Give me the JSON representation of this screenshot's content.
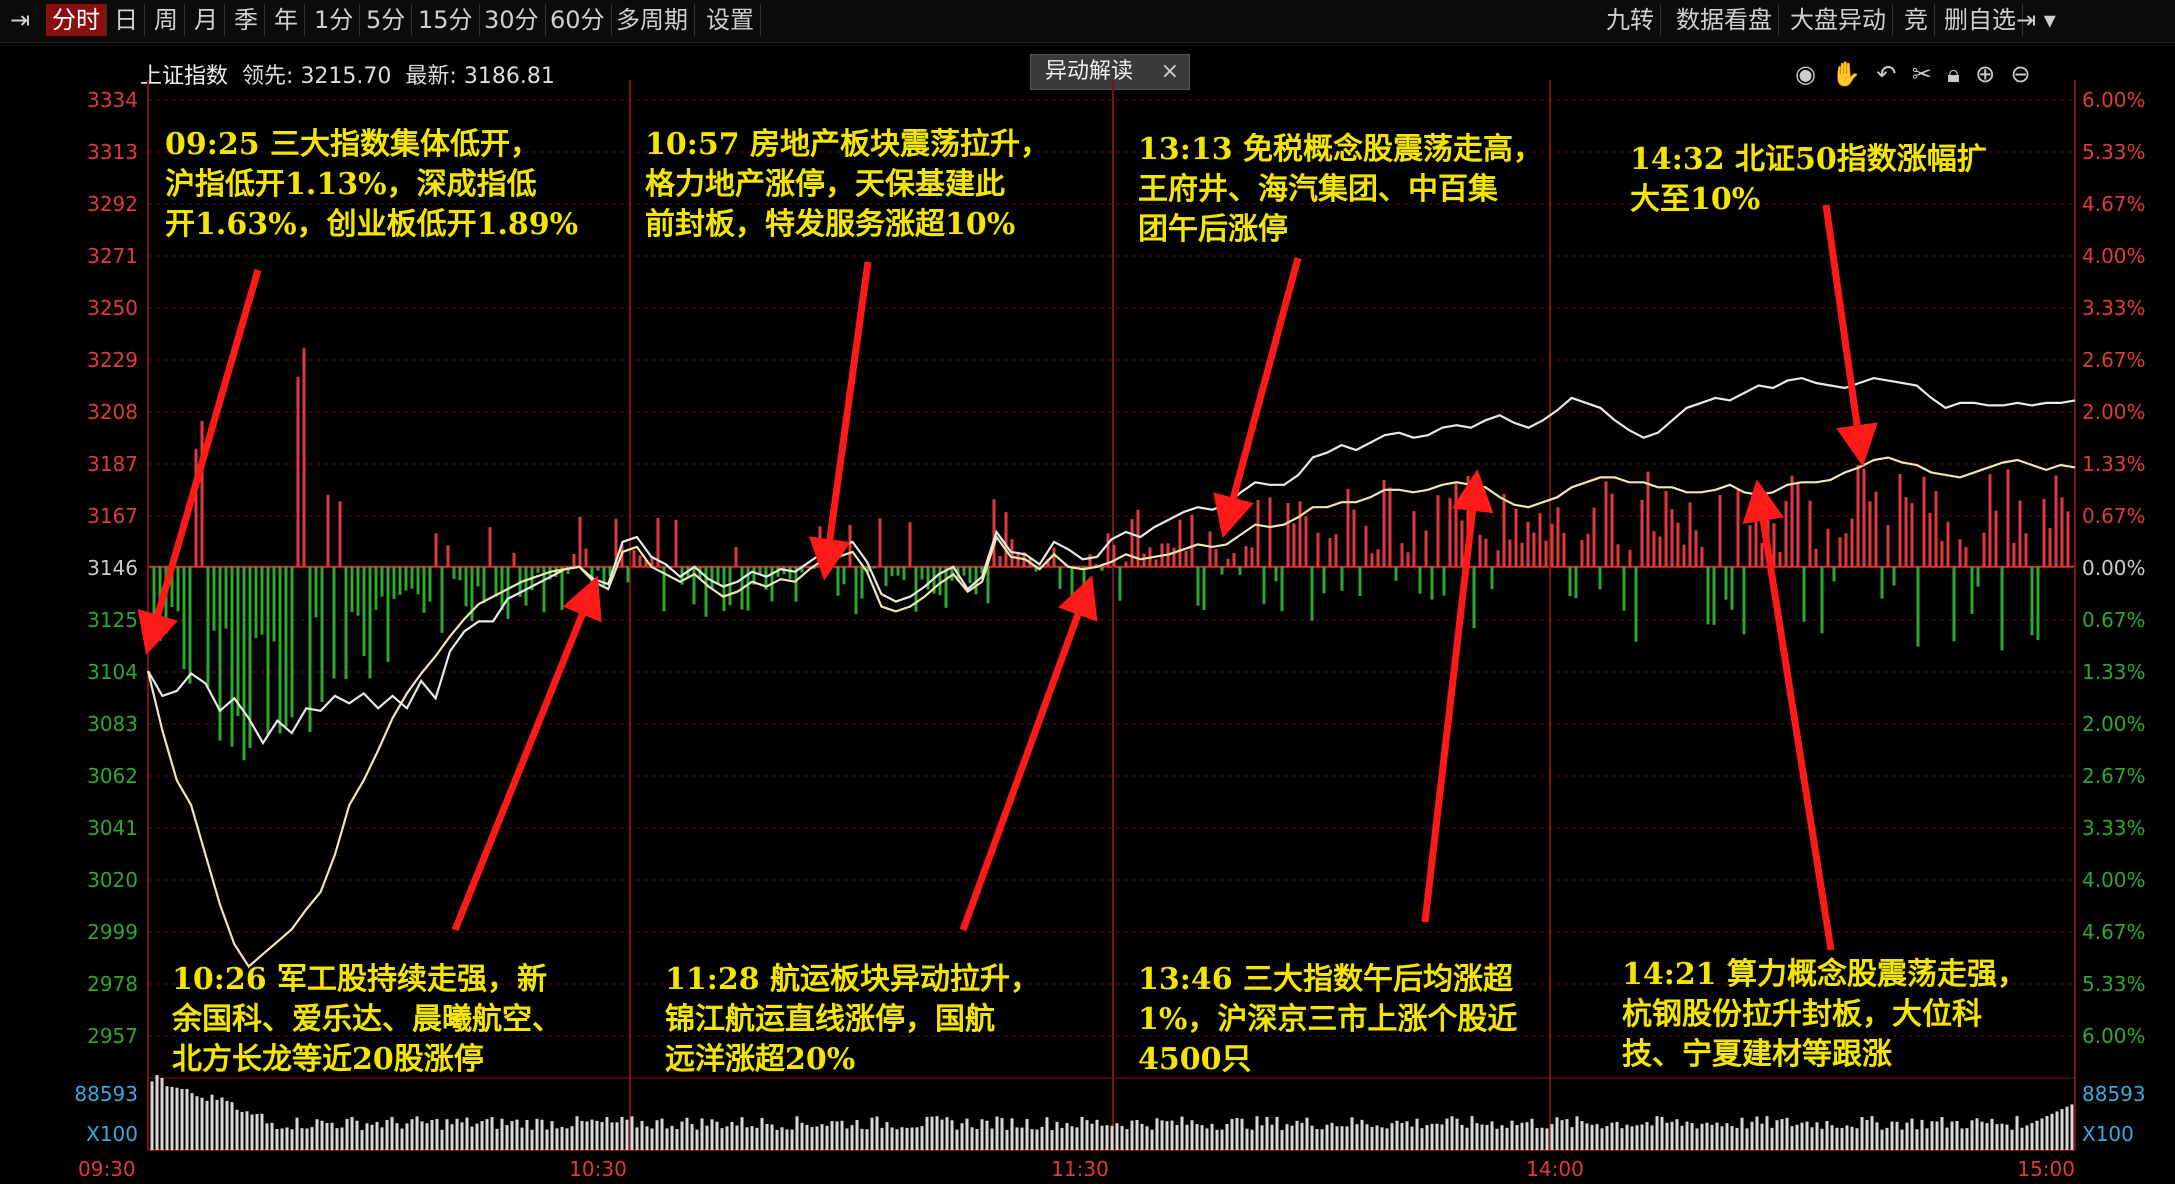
{
  "toolbar": {
    "pin_icon": "pin-icon",
    "tabs": [
      "分时",
      "日",
      "周",
      "月",
      "季",
      "年",
      "1分",
      "5分",
      "15分",
      "30分",
      "60分",
      "多周期",
      "设置"
    ],
    "active_tab": "分时",
    "right_items": [
      "九转",
      "数据看盘",
      "大盘异动",
      "竞",
      "删自选"
    ]
  },
  "info_bar": {
    "index_name": "上证指数",
    "leader_label": "领先:",
    "leader_value": "3215.70",
    "latest_label": "最新:",
    "latest_value": "3186.81"
  },
  "popup": {
    "tab_label": "异动解读",
    "close_glyph": "×"
  },
  "chart_tools": [
    "eye-icon",
    "hand-icon",
    "undo-icon",
    "scissors-icon",
    "lock-icon",
    "zoom-in-icon",
    "zoom-out-icon"
  ],
  "chart_data": {
    "type": "line",
    "title": "",
    "base_price": 3146,
    "y_left_ticks": [
      "3334",
      "3313",
      "3292",
      "3271",
      "3250",
      "3229",
      "3208",
      "3187",
      "3167",
      "3146",
      "3125",
      "3104",
      "3083",
      "3062",
      "3041",
      "3020",
      "2999",
      "2978",
      "2957"
    ],
    "y_right_ticks": [
      "6.00%",
      "5.33%",
      "4.67%",
      "4.00%",
      "3.33%",
      "2.67%",
      "2.00%",
      "1.33%",
      "0.67%",
      "0.00%",
      "0.67%",
      "1.33%",
      "2.00%",
      "2.67%",
      "3.33%",
      "4.00%",
      "4.67%",
      "5.33%",
      "6.00%"
    ],
    "ylim": [
      2957,
      3334
    ],
    "x_ticks": [
      "09:30",
      "10:30",
      "11:30",
      "14:00",
      "15:00"
    ],
    "volume_label": "88593",
    "volume_unit": "X100",
    "series": [
      {
        "color": "#e8e8e8",
        "values": [
          3104,
          3094,
          3096,
          3103,
          3099,
          3088,
          3093,
          3085,
          3075,
          3084,
          3079,
          3089,
          3088,
          3094,
          3091,
          3095,
          3089,
          3094,
          3089,
          3100,
          3093,
          3112,
          3120,
          3124,
          3124,
          3133,
          3136,
          3139,
          3142,
          3145,
          3146,
          3141,
          3139,
          3156,
          3158,
          3150,
          3147,
          3142,
          3146,
          3141,
          3138,
          3140,
          3144,
          3142,
          3145,
          3144,
          3148,
          3152,
          3154,
          3156,
          3148,
          3135,
          3132,
          3134,
          3138,
          3143,
          3146,
          3137,
          3142,
          3160,
          3152,
          3151,
          3147,
          3156,
          3153,
          3149,
          3150,
          3157,
          3160,
          3158,
          3162,
          3165,
          3168,
          3170,
          3169,
          3171,
          3176,
          3180,
          3179,
          3179,
          3183,
          3190,
          3192,
          3195,
          3193,
          3196,
          3199,
          3200,
          3198,
          3199,
          3202,
          3203,
          3202,
          3205,
          3207,
          3204,
          3202,
          3205,
          3209,
          3214,
          3212,
          3210,
          3205,
          3201,
          3198,
          3200,
          3205,
          3210,
          3212,
          3214,
          3213,
          3216,
          3219,
          3218,
          3221,
          3222,
          3220,
          3219,
          3218,
          3220,
          3222,
          3221,
          3220,
          3219,
          3214,
          3210,
          3212,
          3212,
          3211,
          3211,
          3212,
          3211,
          3212,
          3212,
          3213
        ]
      },
      {
        "color": "#f0e6b0",
        "values": [
          3104,
          3080,
          3060,
          3050,
          3030,
          3010,
          2994,
          2985,
          2990,
          2995,
          3000,
          3008,
          3015,
          3030,
          3050,
          3060,
          3072,
          3085,
          3095,
          3103,
          3110,
          3118,
          3125,
          3131,
          3134,
          3137,
          3140,
          3142,
          3144,
          3145,
          3146,
          3140,
          3137,
          3152,
          3154,
          3146,
          3143,
          3140,
          3143,
          3138,
          3134,
          3136,
          3140,
          3138,
          3141,
          3140,
          3145,
          3149,
          3150,
          3152,
          3144,
          3130,
          3128,
          3130,
          3134,
          3139,
          3143,
          3136,
          3140,
          3158,
          3150,
          3149,
          3145,
          3151,
          3146,
          3145,
          3146,
          3148,
          3151,
          3149,
          3150,
          3151,
          3153,
          3155,
          3154,
          3155,
          3159,
          3163,
          3162,
          3163,
          3166,
          3170,
          3170,
          3172,
          3172,
          3174,
          3177,
          3177,
          3176,
          3177,
          3179,
          3180,
          3179,
          3178,
          3174,
          3171,
          3170,
          3172,
          3174,
          3178,
          3180,
          3182,
          3182,
          3180,
          3180,
          3178,
          3178,
          3176,
          3176,
          3177,
          3179,
          3176,
          3175,
          3176,
          3179,
          3180,
          3180,
          3181,
          3184,
          3186,
          3189,
          3190,
          3188,
          3187,
          3184,
          3183,
          3182,
          3184,
          3186,
          3188,
          3189,
          3187,
          3185,
          3187,
          3186
        ]
      }
    ]
  },
  "annotations": [
    {
      "time": "09:25",
      "text": "09:25 三大指数集体低开，\n沪指低开1.13%，深成指低\n开1.63%，创业板低开1.89%"
    },
    {
      "time": "10:57",
      "text": "10:57 房地产板块震荡拉升，\n格力地产涨停，天保基建此\n前封板，特发服务涨超10%"
    },
    {
      "time": "13:13",
      "text": "13:13 免税概念股震荡走高，\n王府井、海汽集团、中百集\n团午后涨停"
    },
    {
      "time": "14:32",
      "text": "14:32 北证50指数涨幅扩\n大至10%"
    },
    {
      "time": "10:26",
      "text": "10:26 军工股持续走强，新\n余国科、爱乐达、晨曦航空、\n北方长龙等近20股涨停"
    },
    {
      "time": "11:28",
      "text": "11:28 航运板块异动拉升，\n锦江航运直线涨停，国航\n远洋涨超20%"
    },
    {
      "time": "13:46",
      "text": "13:46 三大指数午后均涨超\n1%，沪深京三市上涨个股近\n4500只"
    },
    {
      "time": "14:21",
      "text": "14:21 算力概念股震荡走强，\n杭钢股份拉升封板，大位科\n技、宁夏建材等跟涨"
    }
  ],
  "colors": {
    "up": "#e23a3a",
    "down": "#2fa82f",
    "grid": "#5a0e0e",
    "annotation": "#f2e600",
    "arrow": "#ff1a1a"
  }
}
